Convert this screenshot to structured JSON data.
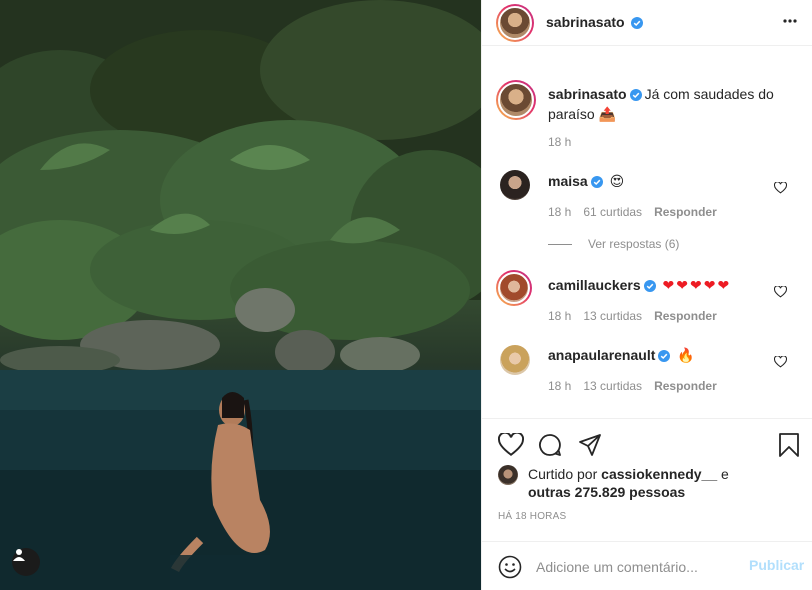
{
  "post": {
    "author": "sabrinasato",
    "caption_text": "Já com saudades do paraíso 📤",
    "caption_time": "18 h"
  },
  "comments": [
    {
      "user": "maisa",
      "text": "😍",
      "time": "18 h",
      "likes": "61 curtidas",
      "reply": "Responder",
      "view_replies": "Ver respostas (6)"
    },
    {
      "user": "camillauckers",
      "text": "❤❤❤❤❤",
      "time": "18 h",
      "likes": "13 curtidas",
      "reply": "Responder"
    },
    {
      "user": "anapaularenault",
      "text": "🔥",
      "time": "18 h",
      "likes": "13 curtidas",
      "reply": "Responder"
    }
  ],
  "likes": {
    "prefix": "Curtido por",
    "user": "cassiokennedy__",
    "connector": "e",
    "others": "outras 275.829 pessoas"
  },
  "timestamp": "HÁ 18 HORAS",
  "add_comment": {
    "placeholder": "Adicione um comentário...",
    "post_label": "Publicar"
  },
  "icons": {
    "verified": "verified-badge-icon",
    "more": "more-options-icon",
    "like": "heart-icon",
    "comment": "comment-icon",
    "share": "share-icon",
    "save": "bookmark-icon",
    "emoji": "emoji-icon",
    "tag": "user-tag-icon"
  },
  "colors": {
    "verified": "#3897f0",
    "text": "#262626",
    "muted": "#8e8e8e",
    "post_button_disabled": "#b2dffc",
    "hearts": "#ed1c24"
  }
}
